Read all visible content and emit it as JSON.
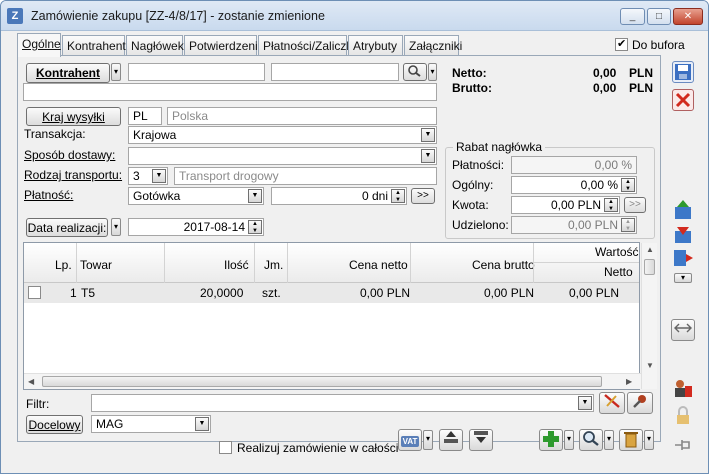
{
  "window": {
    "title": "Zamówienie zakupu [ZZ-4/8/17] - zostanie zmienione",
    "app_icon": "Z",
    "controls": {
      "minimize": "_",
      "maximize": "□",
      "close": "✕"
    }
  },
  "tabs": [
    "Ogólne",
    "Kontrahent",
    "Nagłówek",
    "Potwierdzenie",
    "Płatności/Zaliczki",
    "Atrybuty",
    "Załączniki"
  ],
  "do_bufora": {
    "label": "Do bufora",
    "checked": true
  },
  "kontrahent": {
    "button": "Kontrahent",
    "code": "",
    "name": "",
    "address": ""
  },
  "totals": {
    "netto_label": "Netto:",
    "netto_value": "0,00",
    "brutto_label": "Brutto:",
    "brutto_value": "0,00",
    "currency": "PLN"
  },
  "kraj": {
    "button": "Kraj wysyłki",
    "code": "PL",
    "name": "Polska"
  },
  "form": {
    "transakcja_label": "Transakcja:",
    "transakcja_value": "Krajowa",
    "sposob_label": "Sposób dostawy:",
    "sposob_value": "",
    "rodzaj_label": "Rodzaj transportu:",
    "rodzaj_code": "3",
    "rodzaj_value": "Transport drogowy",
    "platnosc_label": "Płatność:",
    "platnosc_value": "Gotówka",
    "dni_value": "0 dni",
    "dni_button": ">>"
  },
  "data_realizacji": {
    "button": "Data realizacji:",
    "value": "2017-08-14"
  },
  "rabat": {
    "title": "Rabat nagłówka",
    "platnosci_label": "Płatności:",
    "platnosci_value": "0,00 %",
    "ogolny_label": "Ogólny:",
    "ogolny_value": "0,00 %",
    "kwota_label": "Kwota:",
    "kwota_value": "0,00 PLN",
    "kwota_button": ">>",
    "udzielono_label": "Udzielono:",
    "udzielono_value": "0,00 PLN"
  },
  "table": {
    "columns": {
      "lp": "Lp.",
      "towar": "Towar",
      "ilosc": "Ilość",
      "jm": "Jm.",
      "cena_netto": "Cena netto",
      "cena_brutto": "Cena brutto",
      "wartosc": "Wartość",
      "netto": "Netto"
    },
    "rows": [
      {
        "lp": "1",
        "towar": "T5",
        "ilosc": "20,0000",
        "jm": "szt.",
        "cena_netto": "0,00 PLN",
        "cena_brutto": "0,00 PLN",
        "wartosc_netto": "0,00 PLN"
      }
    ]
  },
  "filter": {
    "label": "Filtr:",
    "value": ""
  },
  "docelowy": {
    "button": "Docelowy",
    "value": "MAG"
  },
  "realizuj": {
    "label": "Realizuj zamówienie w całości",
    "checked": false
  },
  "toolbar": {
    "vat_label": "VAT"
  },
  "colors": {
    "save": "#3b6fc2",
    "cancel": "#d22a1e",
    "add": "#2e9a2e",
    "title_gradient": "#c9daee"
  }
}
